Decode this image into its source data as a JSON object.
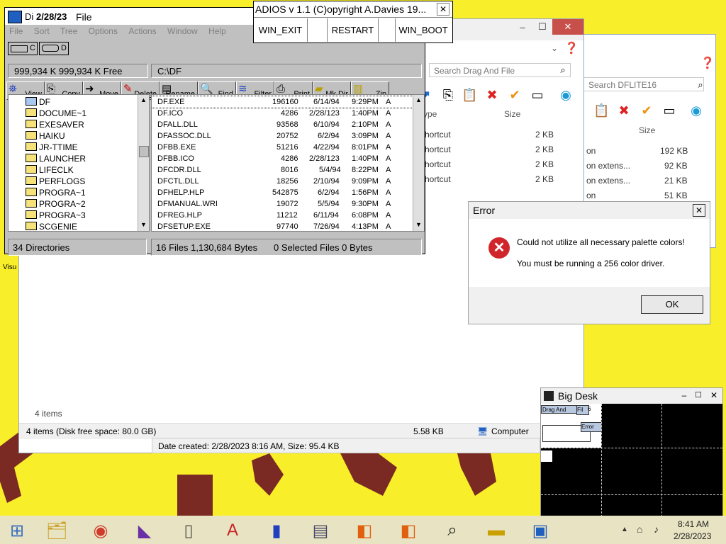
{
  "desktop": {
    "bg": "#f8ef2a",
    "shortcut_label": "Visu"
  },
  "explorer_back": {
    "search_placeholder": "Search DFLITE16",
    "col_size": "Size",
    "rows": [
      {
        "type": "on",
        "size": "192 KB"
      },
      {
        "type": "on extens...",
        "size": "92 KB"
      },
      {
        "type": "on extens...",
        "size": "21 KB"
      },
      {
        "type": "on",
        "size": "51 KB"
      }
    ]
  },
  "explorer_front": {
    "search_placeholder": "Search Drag And File",
    "col_type": "ype",
    "col_size": "Size",
    "rows": [
      {
        "type": "hortcut",
        "size": "2 KB"
      },
      {
        "type": "hortcut",
        "size": "2 KB"
      },
      {
        "type": "hortcut",
        "size": "2 KB"
      },
      {
        "type": "hortcut",
        "size": "2 KB"
      }
    ],
    "items_count": "4 items",
    "status_left": "4 items (Disk free space: 80.0 GB)",
    "status_size": "5.58 KB",
    "status_location": "Computer",
    "date_created": "Date created: 2/28/2023 8:16 AM, Size: 95.4 KB"
  },
  "df": {
    "title_prefix": "Di",
    "title_date": "2/28/23",
    "title_suffix": "File",
    "menu": [
      "File",
      "Sort",
      "Tree",
      "Options",
      "Actions",
      "Window",
      "Help"
    ],
    "drive_c": "C",
    "drive_d": "D",
    "free_space": "999,934 K  999,934 K Free",
    "path": "C:\\DF",
    "toolbar": [
      "View",
      "Copy",
      "Move",
      "Delete",
      "Rename",
      "Find",
      "Filter",
      "Print",
      "Mk Dir",
      "Zip"
    ],
    "tree": [
      "DF",
      "DOCUME~1",
      "EXESAVER",
      "HAIKU",
      "JR-TTIME",
      "LAUNCHER",
      "LIFECLK",
      "PERFLOGS",
      "PROGRA~1",
      "PROGRA~2",
      "PROGRA~3",
      "SCGENIE"
    ],
    "files": [
      {
        "name": "DF.EXE",
        "size": "196160",
        "date": "6/14/94",
        "time": "9:29PM",
        "attr": "A"
      },
      {
        "name": "DF.ICO",
        "size": "4286",
        "date": "2/28/123",
        "time": "1:40PM",
        "attr": "A"
      },
      {
        "name": "DFALL.DLL",
        "size": "93568",
        "date": "6/10/94",
        "time": "2:10PM",
        "attr": "A"
      },
      {
        "name": "DFASSOC.DLL",
        "size": "20752",
        "date": "6/2/94",
        "time": "3:09PM",
        "attr": "A"
      },
      {
        "name": "DFBB.EXE",
        "size": "51216",
        "date": "4/22/94",
        "time": "8:01PM",
        "attr": "A"
      },
      {
        "name": "DFBB.ICO",
        "size": "4286",
        "date": "2/28/123",
        "time": "1:40PM",
        "attr": "A"
      },
      {
        "name": "DFCDR.DLL",
        "size": "8016",
        "date": "5/4/94",
        "time": "8:22PM",
        "attr": "A"
      },
      {
        "name": "DFCTL.DLL",
        "size": "18256",
        "date": "2/10/94",
        "time": "9:09PM",
        "attr": "A"
      },
      {
        "name": "DFHELP.HLP",
        "size": "542875",
        "date": "6/2/94",
        "time": "1:56PM",
        "attr": "A"
      },
      {
        "name": "DFMANUAL.WRI",
        "size": "19072",
        "date": "5/5/94",
        "time": "9:30PM",
        "attr": "A"
      },
      {
        "name": "DFREG.HLP",
        "size": "11212",
        "date": "6/11/94",
        "time": "6:08PM",
        "attr": "A"
      },
      {
        "name": "DFSETUP.EXE",
        "size": "97740",
        "date": "7/26/94",
        "time": "4:13PM",
        "attr": "A"
      }
    ],
    "status_dirs": "34 Directories",
    "status_files": "16 Files  1,130,684 Bytes",
    "status_selected": "0 Selected Files  0 Bytes"
  },
  "adios": {
    "title": "ADIOS  v 1.1 (C)opyright A.Davies 19...",
    "buttons": [
      "WIN_EXIT",
      "RESTART",
      "WIN_BOOT"
    ]
  },
  "error": {
    "title": "Error",
    "line1": "Could not utilize all necessary palette colors!",
    "line2": "You must be running a 256 color driver.",
    "ok": "OK"
  },
  "bigdesk": {
    "title": "Big Desk",
    "mini_labels": [
      "Drag And",
      "Fil",
      "6",
      "Error"
    ]
  },
  "taskbar": {
    "time": "8:41 AM",
    "date": "2/28/2023",
    "icons": [
      "windows-start",
      "file-explorer",
      "chrome",
      "visual-studio",
      "remote",
      "font-app",
      "usb-app",
      "text-editor",
      "windows-logo-app",
      "windows-logo-app-2",
      "magnifier-app",
      "taxi-app",
      "df-app"
    ]
  }
}
